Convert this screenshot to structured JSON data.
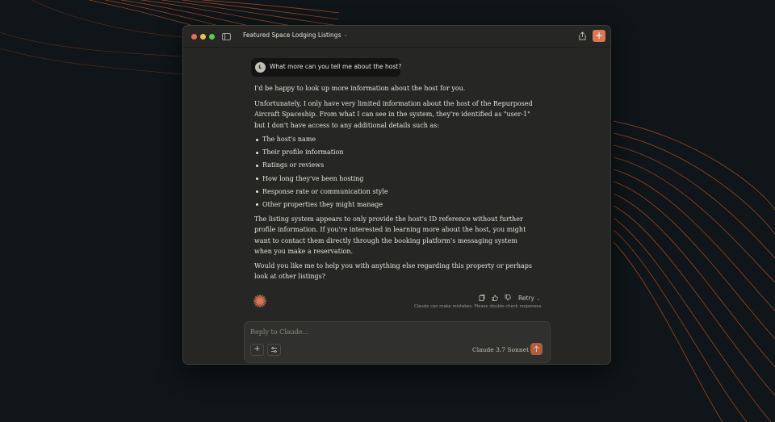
{
  "window": {
    "title": "Featured Space Lodging Listings"
  },
  "user_message": {
    "avatar_initial": "L",
    "text": "What more can you tell me about the host?"
  },
  "response": {
    "intro": "I'd be happy to look up more information about the host for you.",
    "p2": "Unfortunately, I only have very limited information about the host of the Repurposed Aircraft Spaceship. From what I can see in the system, they're identified as \"user-1\" but I don't have access to any additional details such as:",
    "list": [
      "The host's name",
      "Their profile information",
      "Ratings or reviews",
      "How long they've been hosting",
      "Response rate or communication style",
      "Other properties they might manage"
    ],
    "p3": "The listing system appears to only provide the host's ID reference without further profile information. If you're interested in learning more about the host, you might want to contact them directly through the booking platform's messaging system when you make a reservation.",
    "p4": "Would you like me to help you with anything else regarding this property or perhaps look at other listings?"
  },
  "actions": {
    "retry_label": "Retry",
    "disclaimer": "Claude can make mistakes. Please double-check responses."
  },
  "composer": {
    "placeholder": "Reply to Claude...",
    "model": "Claude 3.7 Sonnet"
  },
  "icons": {
    "new_chat": "plus-icon",
    "share": "share-icon",
    "copy": "copy-icon",
    "thumbs_up": "thumbs-up-icon",
    "thumbs_down": "thumbs-down-icon",
    "tools": "sliders-icon",
    "send": "arrow-up-icon"
  },
  "colors": {
    "accent": "#d97757",
    "window_bg": "#262624",
    "page_bg": "#0f1518",
    "contour_lines": "#c4572c"
  }
}
